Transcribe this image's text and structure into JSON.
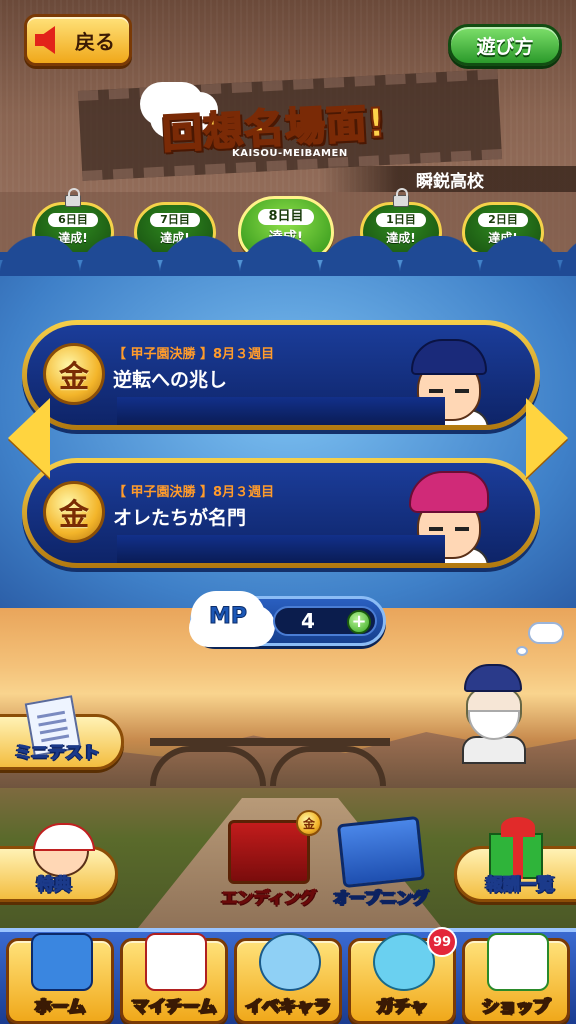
{
  "header": {
    "back_label": "戻る",
    "howto_label": "遊び方",
    "logo_title": "回想名場面!",
    "logo_subtitle": "KAISOU-MEIBAMEN",
    "school_name": "瞬鋭高校"
  },
  "days": [
    {
      "label": "6日目",
      "status": "達成!",
      "locked": true
    },
    {
      "label": "7日目",
      "status": "達成!",
      "locked": false
    },
    {
      "label": "8日目",
      "status": "達成!",
      "locked": false,
      "active": true
    },
    {
      "label": "1日目",
      "status": "達成!",
      "locked": true
    },
    {
      "label": "2日目",
      "status": "達成!",
      "locked": false
    }
  ],
  "scenes": [
    {
      "medal": "金",
      "meta": "【 甲子園決勝 】8月３週目",
      "title": "逆転への兆し",
      "character": "blue-cap-player"
    },
    {
      "medal": "金",
      "meta": "【 甲子園決勝 】8月３週目",
      "title": "オレたちが名門",
      "character": "pink-hair-player"
    }
  ],
  "mp": {
    "label": "MP",
    "value": "4",
    "plus": "+"
  },
  "menu": {
    "mini_test": "ミニテスト",
    "bonus": "特典",
    "ending": "エンディング",
    "ending_medal": "金",
    "opening": "オープニング",
    "rewards": "報酬一覧"
  },
  "tabs": [
    {
      "label": "ホーム",
      "icon": "notebook-icon"
    },
    {
      "label": "マイチーム",
      "icon": "team-icon"
    },
    {
      "label": "イベキャラ",
      "icon": "event-character-icon"
    },
    {
      "label": "ガチャ",
      "icon": "gacha-icon",
      "badge": "99"
    },
    {
      "label": "ショップ",
      "icon": "shop-icon"
    }
  ]
}
